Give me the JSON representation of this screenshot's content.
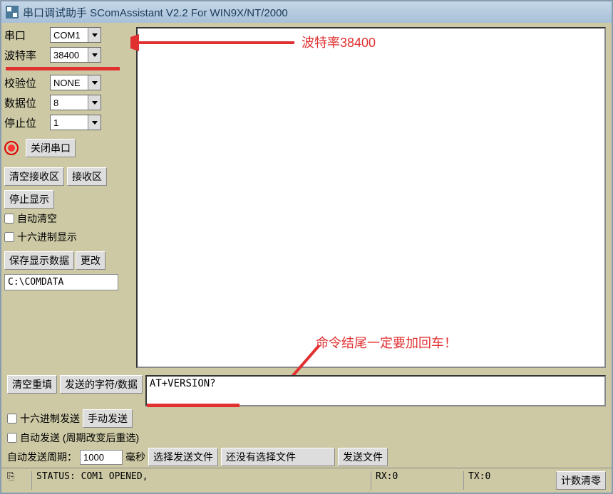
{
  "titlebar": {
    "title": "串口调试助手 SComAssistant V2.2 For WIN9X/NT/2000"
  },
  "settings": {
    "port_label": "串口",
    "port_value": "COM1",
    "baud_label": "波特率",
    "baud_value": "38400",
    "parity_label": "校验位",
    "parity_value": "NONE",
    "databits_label": "数据位",
    "databits_value": "8",
    "stopbits_label": "停止位",
    "stopbits_value": "1",
    "close_port": "关闭串口"
  },
  "recv": {
    "clear_recv": "清空接收区",
    "recv_area": "接收区",
    "stop_display": "停止显示",
    "auto_clear": "自动清空",
    "hex_display": "十六进制显示",
    "save_display_data": "保存显示数据",
    "modify": "更改",
    "path": "C:\\COMDATA"
  },
  "send": {
    "clear_refill": "清空重填",
    "sent_chars_data": "发送的字符/数据",
    "hex_send": "十六进制发送",
    "manual_send": "手动发送",
    "auto_send": "自动发送 (周期改变后重选)",
    "auto_send_period": "自动发送周期：",
    "period_value": "1000",
    "ms_label": "毫秒",
    "select_send_file": "选择发送文件",
    "no_file_selected": "还没有选择文件",
    "send_file": "发送文件",
    "send_input_value": "AT+VERSION?"
  },
  "status": {
    "label": "STATUS: COM1 OPENED,",
    "rx": "RX:0",
    "tx": "TX:0",
    "counter_clear": "计数清零"
  },
  "annotations": {
    "baud_note": "波特率38400",
    "cr_note": "命令结尾一定要加回车！"
  }
}
